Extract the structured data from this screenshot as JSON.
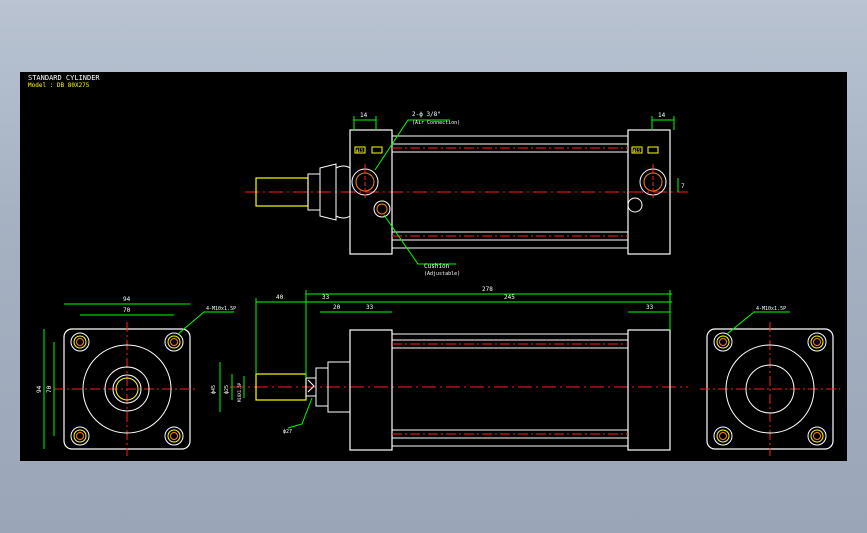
{
  "title_block": {
    "title": "STANDARD CYLINDER",
    "model": "Model : DB 80X275"
  },
  "top_view": {
    "dim_left_port": "14",
    "dim_right_port": "14",
    "port_callout": "2-ф 3/8\"",
    "port_callout_sub": "(Air Connection)",
    "port_tag_left": "ф15",
    "port_tag_right": "ф15",
    "cushion_label": "Cushion",
    "cushion_sub": "(Adjustable)",
    "dim_right_offset": "7"
  },
  "side_view": {
    "dim_overall": "278",
    "dim_rod_ext": "40",
    "dim_rod_boss": "33",
    "dim_body": "245",
    "dim_flange": "20",
    "dim_head": "33",
    "dim_tail": "33",
    "dim_shaft_dia": "ф45",
    "dim_rod_dia": "ф25",
    "dim_thread": "M18X1.5P",
    "dim_nut": "ф27"
  },
  "end_view_left": {
    "dim_width": "94",
    "dim_bolt_pitch": "70",
    "dim_height": "94",
    "dim_height_pitch": "70",
    "thread_callout": "4-M10x1.5P"
  },
  "end_view_right": {
    "thread_callout": "4-M10x1.5P"
  },
  "colors": {
    "background": "#000000",
    "outline": "#ffffff",
    "centerline": "#ff2020",
    "dimension": "#00ff00",
    "hidden": "#ffff00",
    "hatch": "#ff7f00",
    "frame": "#a6b1c2"
  }
}
